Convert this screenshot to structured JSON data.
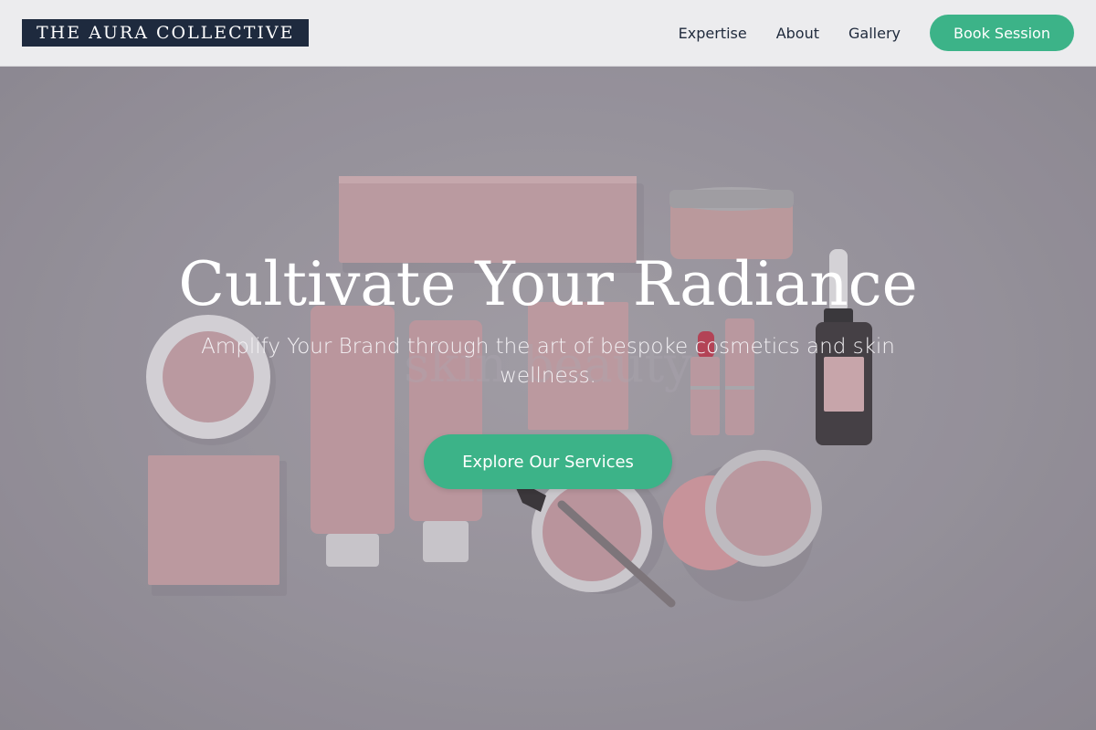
{
  "header": {
    "logo_text": "THE AURA COLLECTIVE",
    "nav": [
      {
        "label": "Expertise"
      },
      {
        "label": "About"
      },
      {
        "label": "Gallery"
      }
    ],
    "cta_label": "Book Session"
  },
  "hero": {
    "title": "Cultivate Your Radiance",
    "subtitle": "Amplify Your Brand through the art of bespoke cosmetics and skin wellness.",
    "button_label": "Explore Our Services"
  },
  "colors": {
    "accent": "#3cb388",
    "logo_bg": "#1e2a3e",
    "header_bg": "#ececee",
    "product_pink": "#d9aab0"
  }
}
